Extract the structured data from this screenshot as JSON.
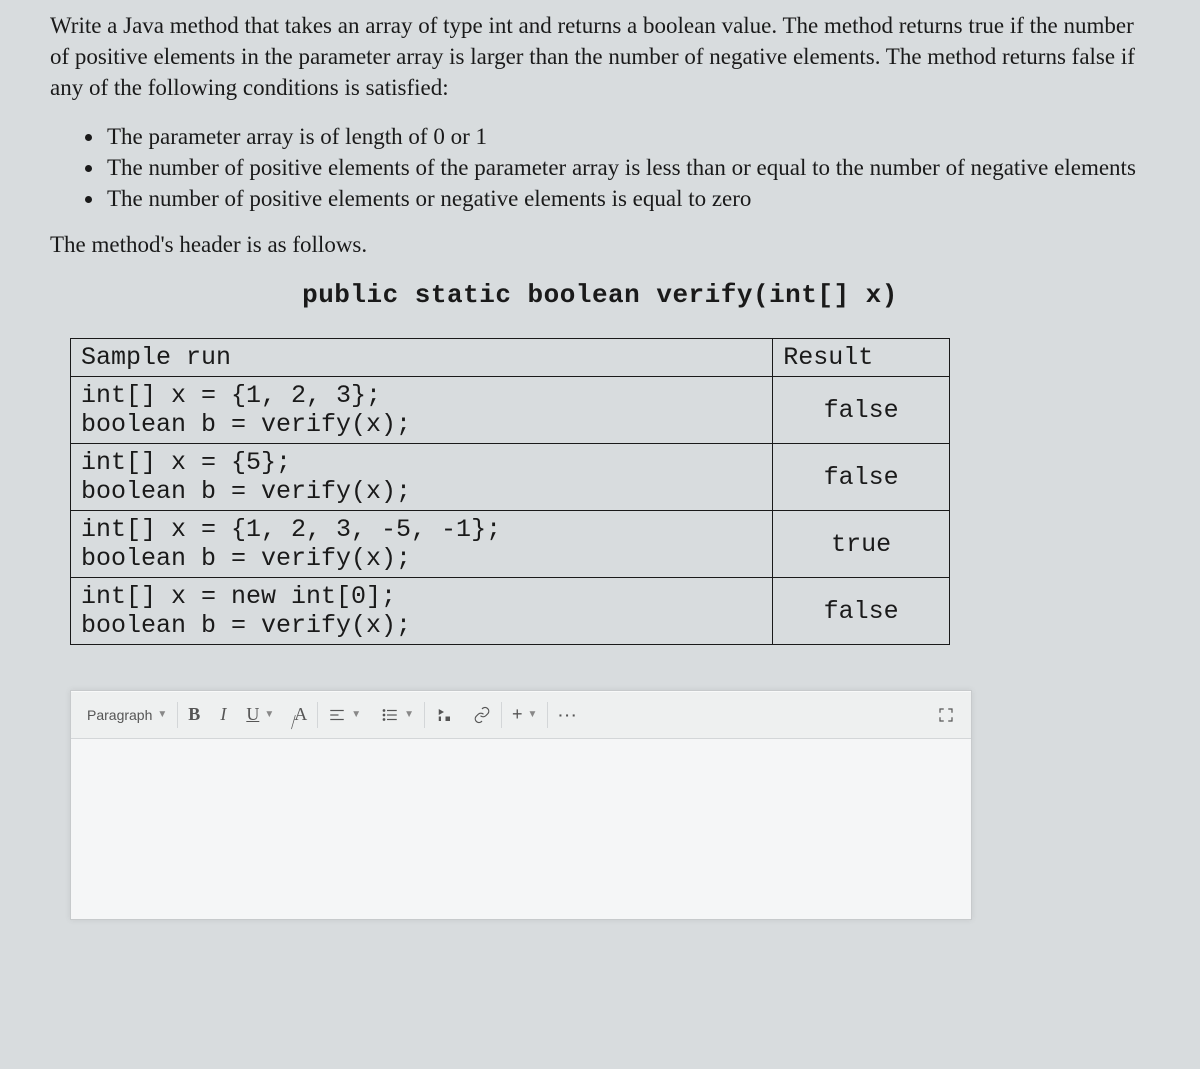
{
  "question": {
    "intro": "Write a Java method that takes an array of type int and returns a boolean value. The method returns true if the number of positive elements in the parameter array is larger than the number of negative elements. The method returns false if any of the following conditions is satisfied:",
    "bullets": [
      "The parameter array is of length of 0 or 1",
      "The number of positive elements of the parameter array is less than or equal to the number of negative elements",
      "The number of positive elements or negative elements is equal to zero"
    ],
    "header_follows": "The method's header is as follows.",
    "signature": "public static boolean verify(int[] x)"
  },
  "table": {
    "headers": {
      "sample": "Sample run",
      "result": "Result"
    },
    "rows": [
      {
        "line1": "int[] x = {1, 2, 3};",
        "line2": "boolean b = verify(x);",
        "result": "false"
      },
      {
        "line1": "int[] x = {5};",
        "line2": "boolean b = verify(x);",
        "result": "false"
      },
      {
        "line1": "int[] x = {1, 2, 3, -5, -1};",
        "line2": "boolean b = verify(x);",
        "result": "true"
      },
      {
        "line1": "int[] x = new int[0];",
        "line2": "boolean b = verify(x);",
        "result": "false"
      }
    ]
  },
  "toolbar": {
    "paragraph": "Paragraph",
    "bold": "B",
    "italic": "I",
    "underline": "U",
    "strike": "A⁄",
    "plus": "+",
    "more": "···"
  }
}
